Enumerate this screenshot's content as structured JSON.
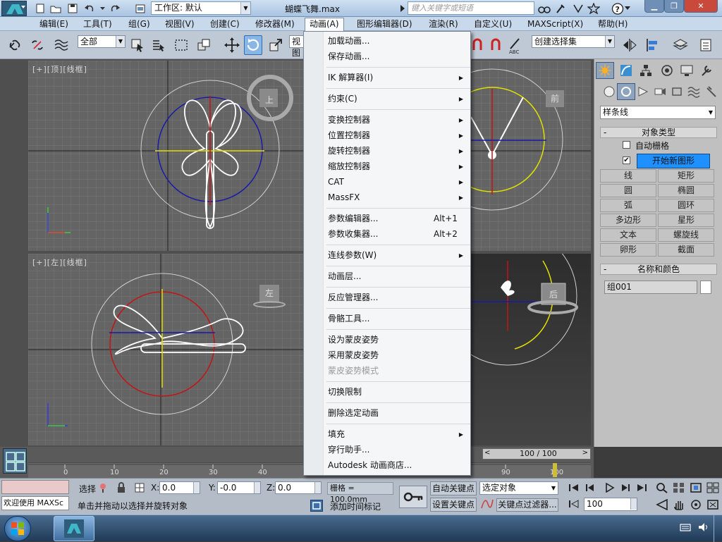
{
  "titlebar": {
    "workspace": "工作区: 默认",
    "title": "蝴蝶飞舞.max",
    "search_placeholder": "键入关键字或短语"
  },
  "menubar": {
    "items": [
      "编辑(E)",
      "工具(T)",
      "组(G)",
      "视图(V)",
      "创建(C)",
      "修改器(M)",
      "动画(A)",
      "图形编辑器(D)",
      "渲染(R)",
      "自定义(U)",
      "MAXScript(X)",
      "帮助(H)"
    ]
  },
  "toolbar": {
    "filter_value": "全部",
    "view_value": "视图",
    "selection_set_value": "创建选择集"
  },
  "viewports": {
    "top_label": "[+][顶][线框]",
    "left_label": "[+][左][线框]",
    "top_cube": "上",
    "front_cube": "前",
    "left_cube": "左",
    "persp_cube": "后"
  },
  "anim_menu": {
    "items": [
      {
        "label": "加载动画...",
        "shortcut": "",
        "submenu": false
      },
      {
        "label": "保存动画...",
        "shortcut": "",
        "submenu": false
      },
      {
        "label": "IK 解算器(I)",
        "shortcut": "",
        "submenu": true
      },
      {
        "label": "约束(C)",
        "shortcut": "",
        "submenu": true
      },
      {
        "label": "变换控制器",
        "shortcut": "",
        "submenu": true
      },
      {
        "label": "位置控制器",
        "shortcut": "",
        "submenu": true
      },
      {
        "label": "旋转控制器",
        "shortcut": "",
        "submenu": true
      },
      {
        "label": "缩放控制器",
        "shortcut": "",
        "submenu": true
      },
      {
        "label": "CAT",
        "shortcut": "",
        "submenu": true
      },
      {
        "label": "MassFX",
        "shortcut": "",
        "submenu": true
      },
      {
        "label": "参数编辑器...",
        "shortcut": "Alt+1",
        "submenu": false
      },
      {
        "label": "参数收集器...",
        "shortcut": "Alt+2",
        "submenu": false
      },
      {
        "label": "连线参数(W)",
        "shortcut": "",
        "submenu": true
      },
      {
        "label": "动画层...",
        "shortcut": "",
        "submenu": false
      },
      {
        "label": "反应管理器...",
        "shortcut": "",
        "submenu": false
      },
      {
        "label": "骨骼工具...",
        "shortcut": "",
        "submenu": false
      },
      {
        "label": "设为蒙皮姿势",
        "shortcut": "",
        "submenu": false
      },
      {
        "label": "采用蒙皮姿势",
        "shortcut": "",
        "submenu": false
      },
      {
        "label": "蒙皮姿势模式",
        "shortcut": "",
        "submenu": false,
        "disabled": true
      },
      {
        "label": "切换限制",
        "shortcut": "",
        "submenu": false
      },
      {
        "label": "删除选定动画",
        "shortcut": "",
        "submenu": false
      },
      {
        "label": "填充",
        "shortcut": "",
        "submenu": true
      },
      {
        "label": "穿行助手...",
        "shortcut": "",
        "submenu": false
      },
      {
        "label": "Autodesk 动画商店...",
        "shortcut": "",
        "submenu": false
      }
    ]
  },
  "command_panel": {
    "category": "样条线",
    "object_type_title": "对象类型",
    "auto_grid": "自动栅格",
    "start_new_shape": "开始新图形",
    "buttons": [
      "线",
      "矩形",
      "圆",
      "椭圆",
      "弧",
      "圆环",
      "多边形",
      "星形",
      "文本",
      "螺旋线",
      "卵形",
      "截面"
    ],
    "name_color_title": "名称和颜色",
    "object_name": "组001"
  },
  "timeline": {
    "frame_counter": "100 / 100",
    "ticks": [
      "0",
      "10",
      "20",
      "30",
      "40",
      "90",
      "100"
    ]
  },
  "status": {
    "welcome": "欢迎使用 MAXSc",
    "selected_label": "选择",
    "x_label": "X:",
    "x_value": "0.0",
    "y_label": "Y:",
    "y_value": "-0.0",
    "z_label": "Z:",
    "z_value": "0.0",
    "grid_value": "栅格 = 100.0mm",
    "prompt": "单击并拖动以选择并旋转对象",
    "add_time_tag": "添加时间标记",
    "auto_key": "自动关键点",
    "set_key": "设置关键点",
    "key_mode_value": "选定对象",
    "key_filters": "关键点过滤器...",
    "current_frame": "100"
  },
  "colors": {
    "accent": "#2f6db3",
    "viewport_bg": "#646464",
    "grid": "#7a7a7a",
    "start_shape_button": "#1e90ff"
  }
}
